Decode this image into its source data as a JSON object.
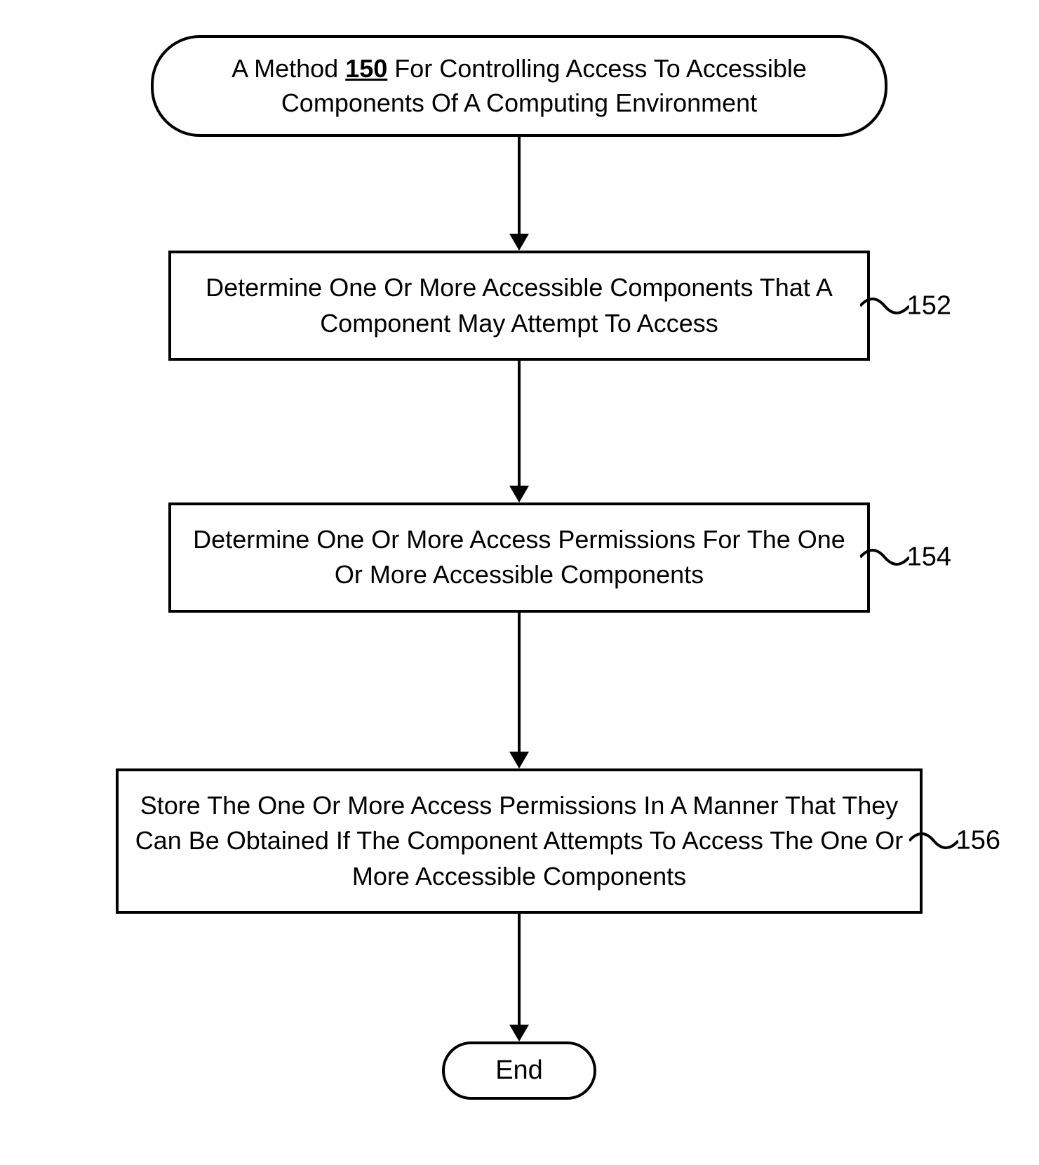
{
  "flowchart": {
    "start": {
      "prefix": "A Method ",
      "ref_number": "150",
      "suffix": " For Controlling Access To Accessible Components Of A Computing Environment"
    },
    "steps": [
      {
        "text": "Determine One Or More Accessible Components That A Component May Attempt To Access",
        "ref": "152"
      },
      {
        "text": "Determine One Or More Access Permissions For The One Or More Accessible Components",
        "ref": "154"
      },
      {
        "text": "Store The One Or More Access Permissions In A Manner That They Can Be Obtained If The Component Attempts To Access The One Or More Accessible Components",
        "ref": "156"
      }
    ],
    "end": "End"
  }
}
